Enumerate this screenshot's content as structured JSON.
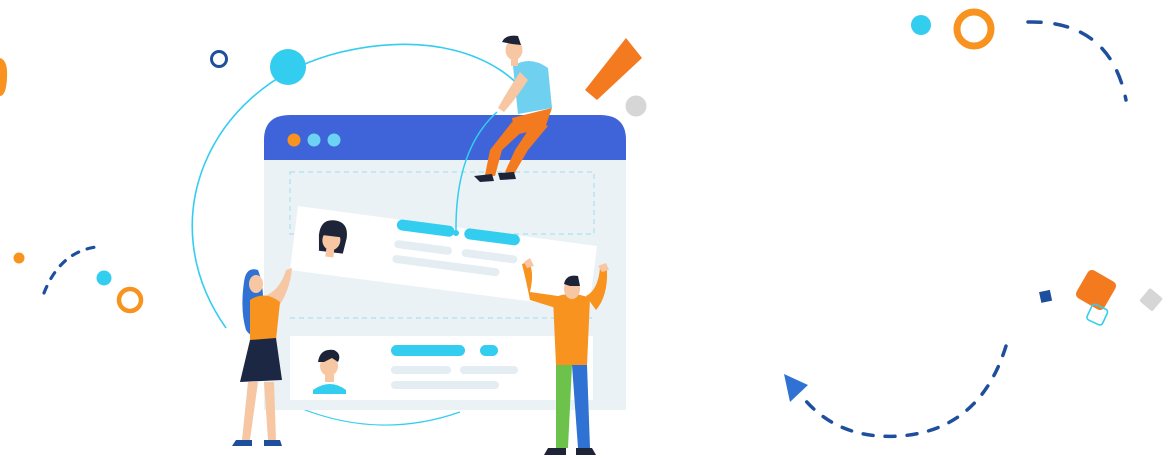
{
  "illustration": {
    "subject": "team-collaboration",
    "colors": {
      "window_header": "#3f63d8",
      "window_body": "#eaf2f6",
      "card": "#ffffff",
      "accent_cyan": "#33cdf0",
      "accent_orange": "#f7931e",
      "deep_orange": "#f47a20",
      "navy": "#1e4f9c",
      "pale_line": "#e3edf2",
      "gray_shape": "#d6d6d6",
      "skin": "#f7c6a3",
      "hair_dark": "#1d2438",
      "person_blue": "#2f72d3",
      "person_green": "#6dc24b",
      "skirt": "#1b2743"
    },
    "window_dots": [
      "#f7931e",
      "#6cd3f4",
      "#6cd3f4"
    ],
    "icons": [
      "browser-window-icon",
      "profile-card-icon",
      "person-icon",
      "dashed-arrow-icon",
      "circle-icon",
      "diamond-icon",
      "triangle-arrow-icon"
    ]
  }
}
